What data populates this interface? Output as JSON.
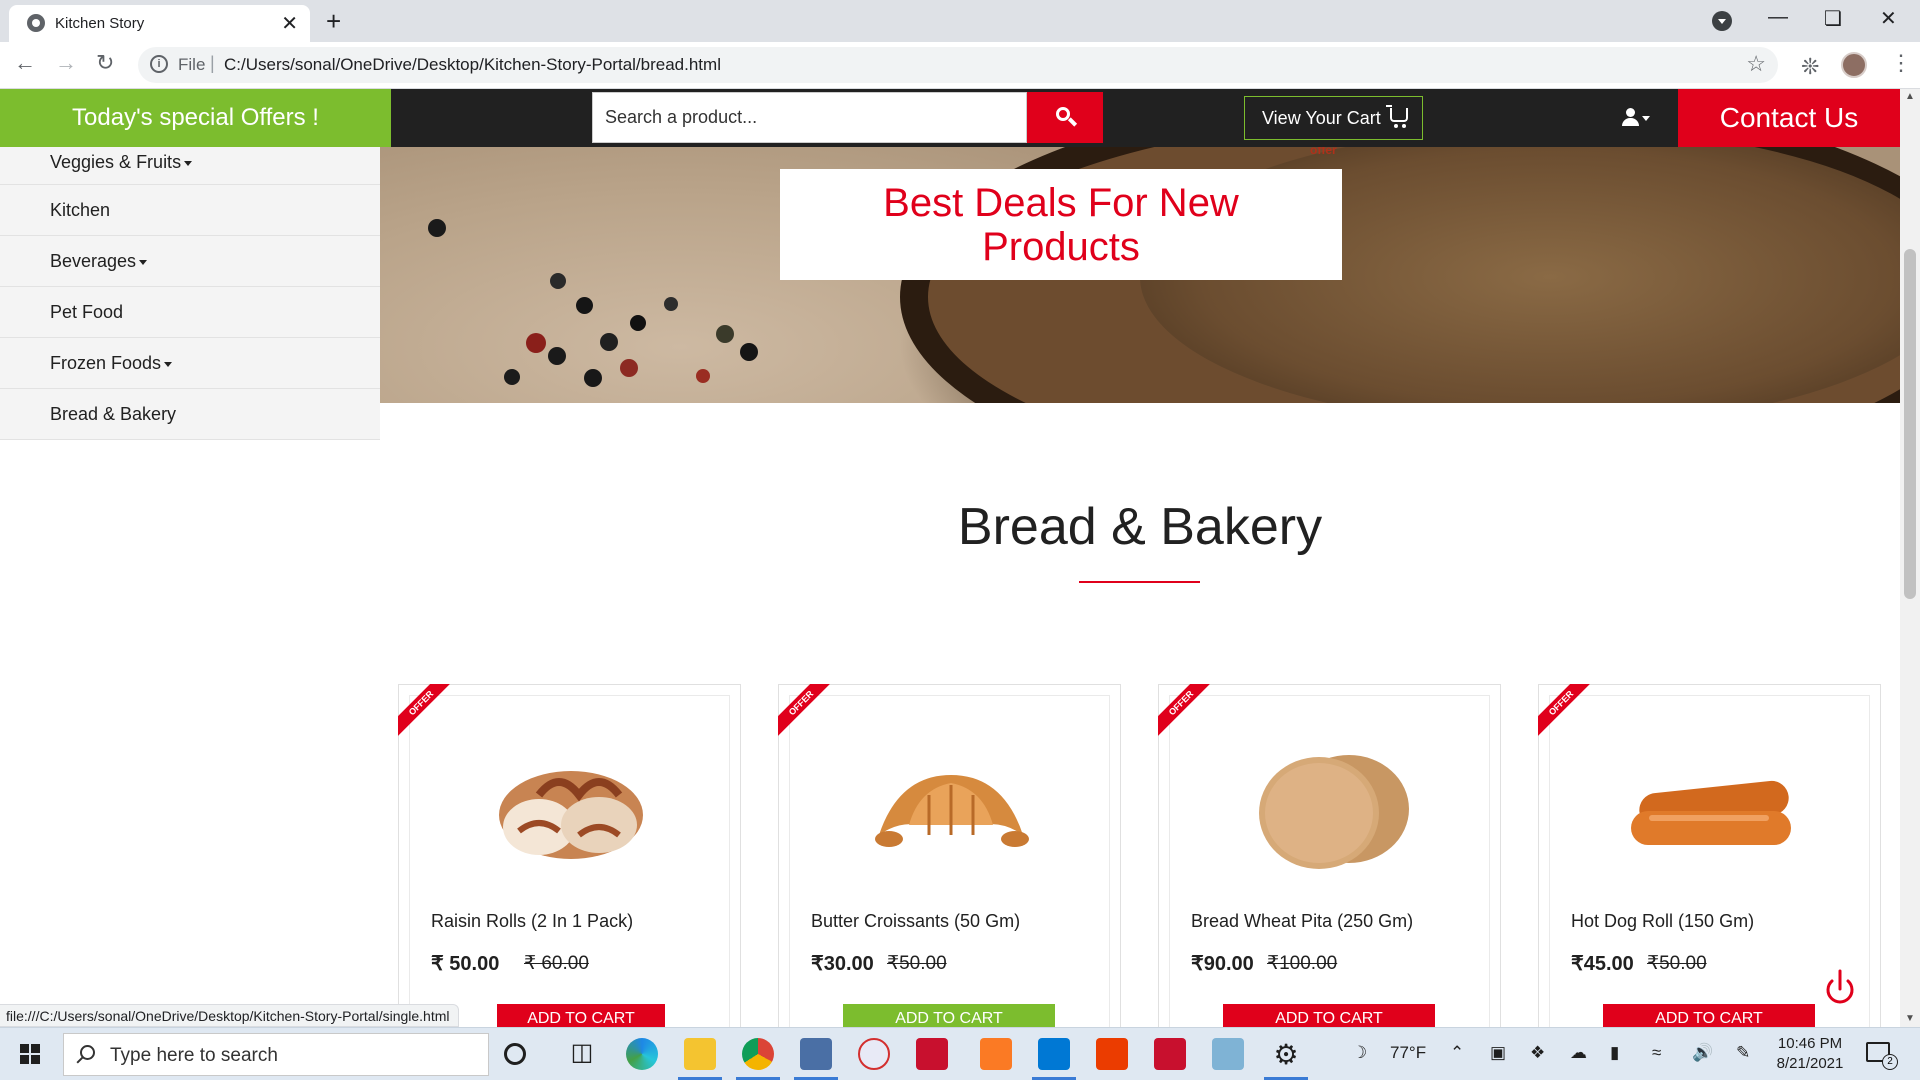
{
  "browser": {
    "tab_title": "Kitchen Story",
    "tab_close": "✕",
    "new_tab": "+",
    "url_scheme": "File",
    "url_separator": "|",
    "url": "C:/Users/sonal/OneDrive/Desktop/Kitchen-Story-Portal/bread.html",
    "status_url": "file:///C:/Users/sonal/OneDrive/Desktop/Kitchen-Story-Portal/single.html"
  },
  "header": {
    "offers_label": "Today's special Offers !",
    "search_placeholder": "Search a product...",
    "cart_label": "View Your Cart",
    "contact_label": "Contact Us"
  },
  "sidebar": {
    "items": [
      {
        "label": "Veggies & Fruits",
        "has_dropdown": true
      },
      {
        "label": "Kitchen",
        "has_dropdown": false
      },
      {
        "label": "Beverages",
        "has_dropdown": true
      },
      {
        "label": "Pet Food",
        "has_dropdown": false
      },
      {
        "label": "Frozen Foods",
        "has_dropdown": true
      },
      {
        "label": "Bread & Bakery",
        "has_dropdown": false
      }
    ]
  },
  "banner": {
    "line1": "Best Deals For New",
    "line2": "Products",
    "peek_text": "offer"
  },
  "section": {
    "title": "Bread & Bakery"
  },
  "products": [
    {
      "name": "Raisin Rolls (2 In 1 Pack)",
      "price": "₹ 50.00",
      "old_price": "₹ 60.00",
      "badge": "OFFER",
      "button": "ADD TO CART",
      "button_color": "#e0001b"
    },
    {
      "name": "Butter Croissants (50 Gm)",
      "price": "₹30.00",
      "old_price": "₹50.00",
      "badge": "OFFER",
      "button": "ADD TO CART",
      "button_color": "#7cbd2e"
    },
    {
      "name": "Bread Wheat Pita (250 Gm)",
      "price": "₹90.00",
      "old_price": "₹100.00",
      "badge": "OFFER",
      "button": "ADD TO CART",
      "button_color": "#e0001b"
    },
    {
      "name": "Hot Dog Roll (150 Gm)",
      "price": "₹45.00",
      "old_price": "₹50.00",
      "badge": "OFFER",
      "button": "ADD TO CART",
      "button_color": "#e0001b"
    }
  ],
  "taskbar": {
    "search_placeholder": "Type here to search",
    "weather": "77°F",
    "time": "10:46 PM",
    "date": "8/21/2021",
    "notification_count": "2"
  },
  "colors": {
    "brand_red": "#e0001b",
    "brand_green": "#7cbd2e",
    "header_dark": "#212121"
  }
}
